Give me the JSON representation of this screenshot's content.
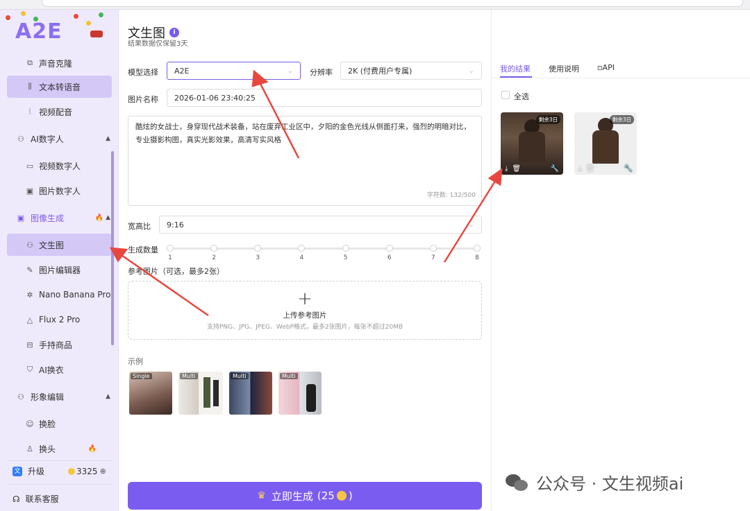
{
  "app": {
    "logo_text": "A2E"
  },
  "sidebar": {
    "items": [
      {
        "label": "声音克隆",
        "icon": "voice-clone-icon",
        "glyph": "⧉"
      },
      {
        "label": "文本转语音",
        "icon": "text-to-speech-icon",
        "glyph": "⫼",
        "active": true
      },
      {
        "label": "视频配音",
        "icon": "dubbing-icon",
        "glyph": "⦙"
      }
    ],
    "groups": {
      "digital_human": {
        "label": "AI数字人",
        "icon": "person-icon",
        "glyph": "⚇"
      },
      "image_gen": {
        "label": "图像生成",
        "icon": "image-icon",
        "glyph": "▣",
        "hot": "🔥"
      },
      "avatar_edit": {
        "label": "形象编辑",
        "icon": "avatar-edit-icon",
        "glyph": "⚇"
      }
    },
    "digital_items": [
      {
        "label": "视频数字人",
        "icon": "video-human-icon",
        "glyph": "▭"
      },
      {
        "label": "图片数字人",
        "icon": "photo-human-icon",
        "glyph": "▣"
      }
    ],
    "image_items": [
      {
        "label": "文生图",
        "icon": "text-to-image-icon",
        "glyph": "⚇",
        "active": true
      },
      {
        "label": "图片编辑器",
        "icon": "image-editor-icon",
        "glyph": "✎"
      },
      {
        "label": "Nano Banana Pro",
        "icon": "spark-icon",
        "glyph": "✲"
      },
      {
        "label": "Flux 2 Pro",
        "icon": "mountain-icon",
        "glyph": "△"
      },
      {
        "label": "手持商品",
        "icon": "product-icon",
        "glyph": "⊟"
      },
      {
        "label": "AI换衣",
        "icon": "shirt-icon",
        "glyph": "⛉"
      }
    ],
    "edit_items": [
      {
        "label": "换脸",
        "icon": "face-swap-icon",
        "glyph": "☺"
      },
      {
        "label": "换头",
        "icon": "head-swap-icon",
        "glyph": "♙",
        "hot": "🔥"
      }
    ],
    "upgrade_label": "升级",
    "credits": "3325",
    "support_label": "联系客服"
  },
  "main": {
    "title": "文生图",
    "subtitle": "结果数据仅保留3天",
    "model_label": "模型选择",
    "model_value": "A2E",
    "resolution_label": "分辨率",
    "resolution_value": "2K (付费用户专属)",
    "name_label": "图片名称",
    "name_value": "2026-01-06 23:40:25",
    "prompt": "酷炫的女战士，身穿现代战术装备，站在废弃工业区中，夕阳的金色光线从侧面打来，强烈的明暗对比，专业摄影构图，真实光影效果，高清写实风格",
    "char_count": "字符数: 132/500",
    "ratio_label": "宽高比",
    "ratio_value": "9:16",
    "count_label": "生成数量",
    "count_ticks": [
      "1",
      "2",
      "3",
      "4",
      "5",
      "6",
      "7",
      "8"
    ],
    "count_selected": 1,
    "ref_label": "参考图片（可选，最多2张）",
    "upload_title": "上传参考图片",
    "upload_hint": "支持PNG、JPG、JPEG、WebP格式，最多2张图片，每张不超过20MB",
    "examples_label": "示例",
    "examples": [
      {
        "tag": "Single"
      },
      {
        "tag": "Multi"
      },
      {
        "tag": "Multi"
      },
      {
        "tag": "Multi"
      }
    ],
    "generate_label": "立即生成",
    "generate_cost": "(25",
    "generate_close": ")"
  },
  "results": {
    "tabs": [
      "我的结果",
      "使用说明",
      "API"
    ],
    "select_all": "全选",
    "items": [
      {
        "badge": "剩余3日"
      },
      {
        "badge": "剩余3日"
      }
    ]
  },
  "watermark": "公众号 · 文生视频ai",
  "colors": {
    "accent": "#7b5cf0",
    "sidebar_bg": "#efeafb",
    "active_item": "#d4c8f7",
    "arrow": "#e8473f"
  }
}
